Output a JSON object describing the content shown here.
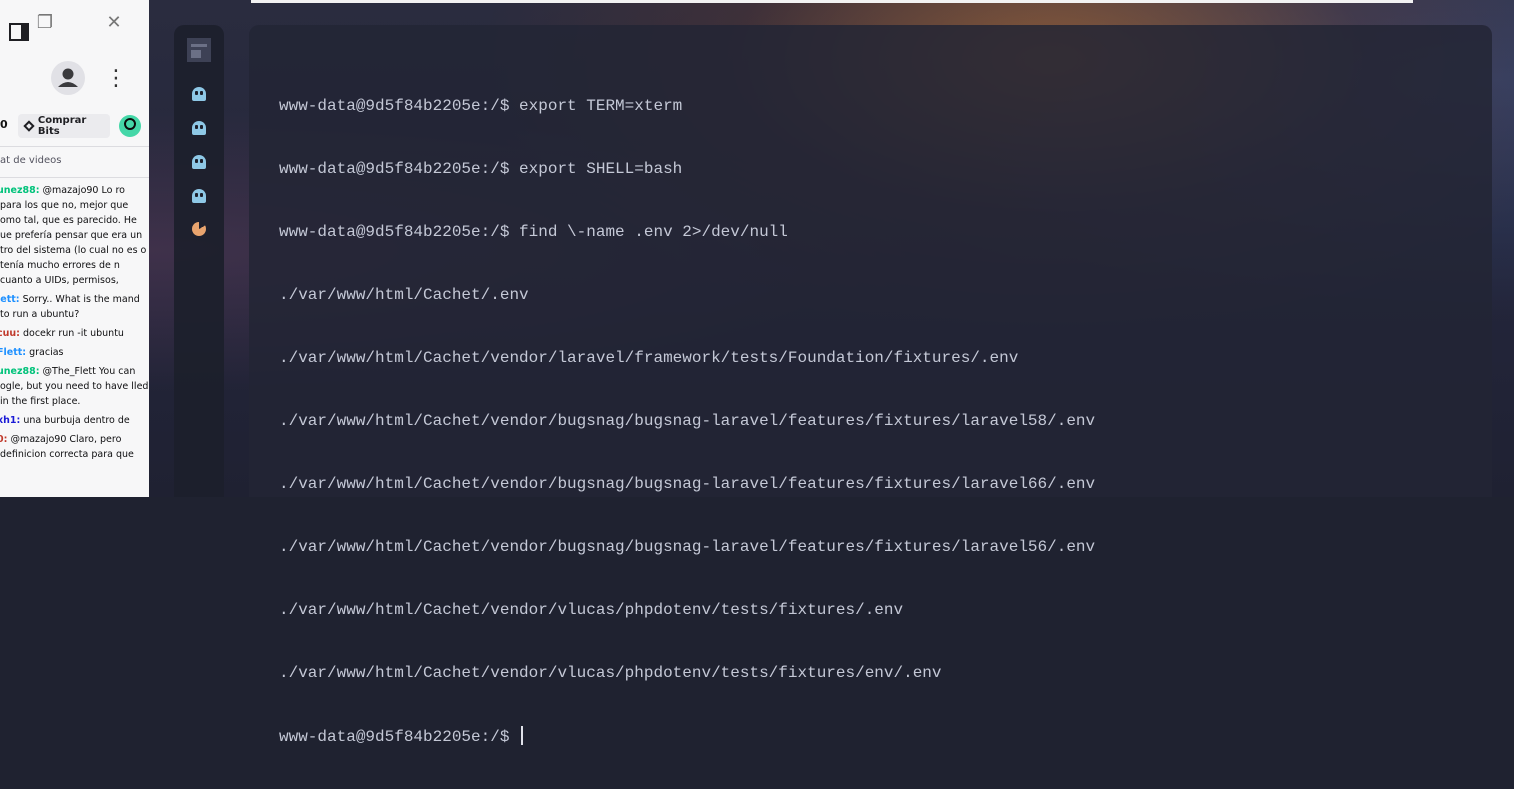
{
  "browser": {
    "restore_glyph": "❐",
    "close_glyph": "✕",
    "more_glyph": "⋮",
    "bits_partial": "0",
    "comprar_bits_label": "Comprar Bits",
    "chat_header": "at de videos"
  },
  "chat": {
    "messages": [
      {
        "user": "unez88:",
        "user_color": "#00c27a",
        "text": " @mazajo90 Lo ro para los que no, mejor que omo tal, que es parecido. He ue prefería pensar que era un tro del sistema (lo cual no es o tenía mucho errores de n cuanto a UIDs, permisos,"
      },
      {
        "user": "lett:",
        "user_color": "#1e90ff",
        "text": " Sorry.. What is the mand to run a ubuntu?"
      },
      {
        "user": "cuu:",
        "user_color": "#c0392b",
        "text": " docekr run -it ubuntu"
      },
      {
        "user": "Flett:",
        "user_color": "#1e90ff",
        "text": " gracias"
      },
      {
        "user": "unez88:",
        "user_color": "#00c27a",
        "text": " @The_Flett You can ogle, but you need to have lled in the first place."
      },
      {
        "user": "xh1:",
        "user_color": "#1a1ad6",
        "text": " una burbuja dentro de"
      },
      {
        "user": "0:",
        "user_color": "#c0392b",
        "text": " @mazajo90 Claro, pero definicion correcta para que"
      }
    ]
  },
  "terminal": {
    "lines": [
      "www-data@9d5f84b2205e:/$ export TERM=xterm",
      "www-data@9d5f84b2205e:/$ export SHELL=bash",
      "www-data@9d5f84b2205e:/$ find \\-name .env 2>/dev/null",
      "./var/www/html/Cachet/.env",
      "./var/www/html/Cachet/vendor/laravel/framework/tests/Foundation/fixtures/.env",
      "./var/www/html/Cachet/vendor/bugsnag/bugsnag-laravel/features/fixtures/laravel58/.env",
      "./var/www/html/Cachet/vendor/bugsnag/bugsnag-laravel/features/fixtures/laravel66/.env",
      "./var/www/html/Cachet/vendor/bugsnag/bugsnag-laravel/features/fixtures/laravel56/.env",
      "./var/www/html/Cachet/vendor/vlucas/phpdotenv/tests/fixtures/.env",
      "./var/www/html/Cachet/vendor/vlucas/phpdotenv/tests/fixtures/env/.env"
    ],
    "prompt": "www-data@9d5f84b2205e:/$ "
  },
  "dock": {
    "icons": [
      "app-logo-icon",
      "ghost-icon",
      "ghost-icon",
      "ghost-icon",
      "ghost-icon",
      "pacman-icon"
    ],
    "ghost_color": "#8ec8e6",
    "pacman_color": "#e9a46e"
  }
}
